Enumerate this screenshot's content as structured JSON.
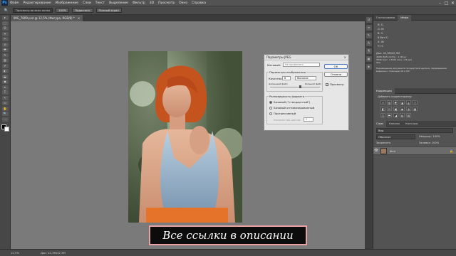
{
  "app": {
    "logo": "Ps"
  },
  "menubar": {
    "items": [
      "Файл",
      "Редактирование",
      "Изображение",
      "Слои",
      "Текст",
      "Выделение",
      "Фильтр",
      "3D",
      "Просмотр",
      "Окно",
      "Справка"
    ],
    "window_controls": [
      "–",
      "□",
      "✕"
    ]
  },
  "options_bar": {
    "tool_glyph": "🔍",
    "fields": [
      "Просмотр во всех окнах",
      "100%",
      "Подогнать",
      "Полный экран"
    ]
  },
  "document": {
    "tab_label": "IMG_7809.psd @ 12,5% (Фигура, RGB/8) *",
    "close_glyph": "×"
  },
  "tools": [
    "▸",
    "⬚",
    "ʘ",
    "⌖",
    "✂",
    "⊘",
    "✚",
    "✎",
    "▥",
    "✐",
    "◐",
    "⬓",
    "◆",
    "✒",
    "T",
    "↖",
    "▭",
    "✋",
    "🔍",
    "⋯"
  ],
  "dialog": {
    "title": "Параметры JPEG",
    "matte_label": "Матовый:",
    "matte_value": "Не применять",
    "image_options_label": "Параметры изображения",
    "quality_label": "Качество:",
    "quality_value": "8",
    "quality_level": "Высокое",
    "small_file": "маленький файл",
    "large_file": "большой файл",
    "format_options_label": "Разновидность формата",
    "format_options": [
      "Базовый (\"стандартный\")",
      "Базовый оптимизированный",
      "Прогрессивный"
    ],
    "scans_label": "Количество шагов:",
    "scans_value": "3",
    "ok_label": "ОК",
    "cancel_label": "Отмена",
    "preview_label": "Просмотр",
    "preview_checked": true,
    "close_glyph": "×"
  },
  "panels": {
    "top_tabs": [
      "Гистограмма",
      "Инфо"
    ],
    "info": {
      "rows": [
        "R:          C:",
        "G:          M:",
        "B:          Y:",
        "8-бит       K:",
        "X:          W:",
        "Y:          H:"
      ],
      "doc_size": "Док: 42,3M/42,3M",
      "detail_lines": [
        "4608 (8х8) (0,0%) - 1 (Фон)",
        "3840 пикс. x 5760 пикс. (72 ppi)",
        "Фон"
      ],
      "hint": "Перемещение документа посредством щелчка, перемещение вершины с помощью Alt и Ctrl"
    },
    "adjustments": {
      "tab": "Коррекция",
      "subtitle": "Добавить корректировку",
      "icons_row1": [
        "☼",
        "▥",
        "◩",
        "◪",
        "◭",
        "▽"
      ],
      "icons_row2": [
        "◧",
        "⚖",
        "▣",
        "◉",
        "◍",
        "▦"
      ],
      "icons_row3": [
        "◫",
        "⬒",
        "◢",
        "▤",
        "▨"
      ]
    },
    "layers": {
      "tabs": [
        "Слои",
        "Каналы",
        "Контуры"
      ],
      "kind_label": "Вид",
      "blend_mode": "Обычные",
      "opacity_label": "Непрозр.: 100%",
      "lock_label": "Закрепить:",
      "fill_label": "Заливка: 100%",
      "layer_name": "Фон",
      "visible": true
    }
  },
  "status": {
    "zoom": "12,5%",
    "doc": "Док: 42,3M/42,3M"
  },
  "subtitle": "Все ссылки в описании"
}
